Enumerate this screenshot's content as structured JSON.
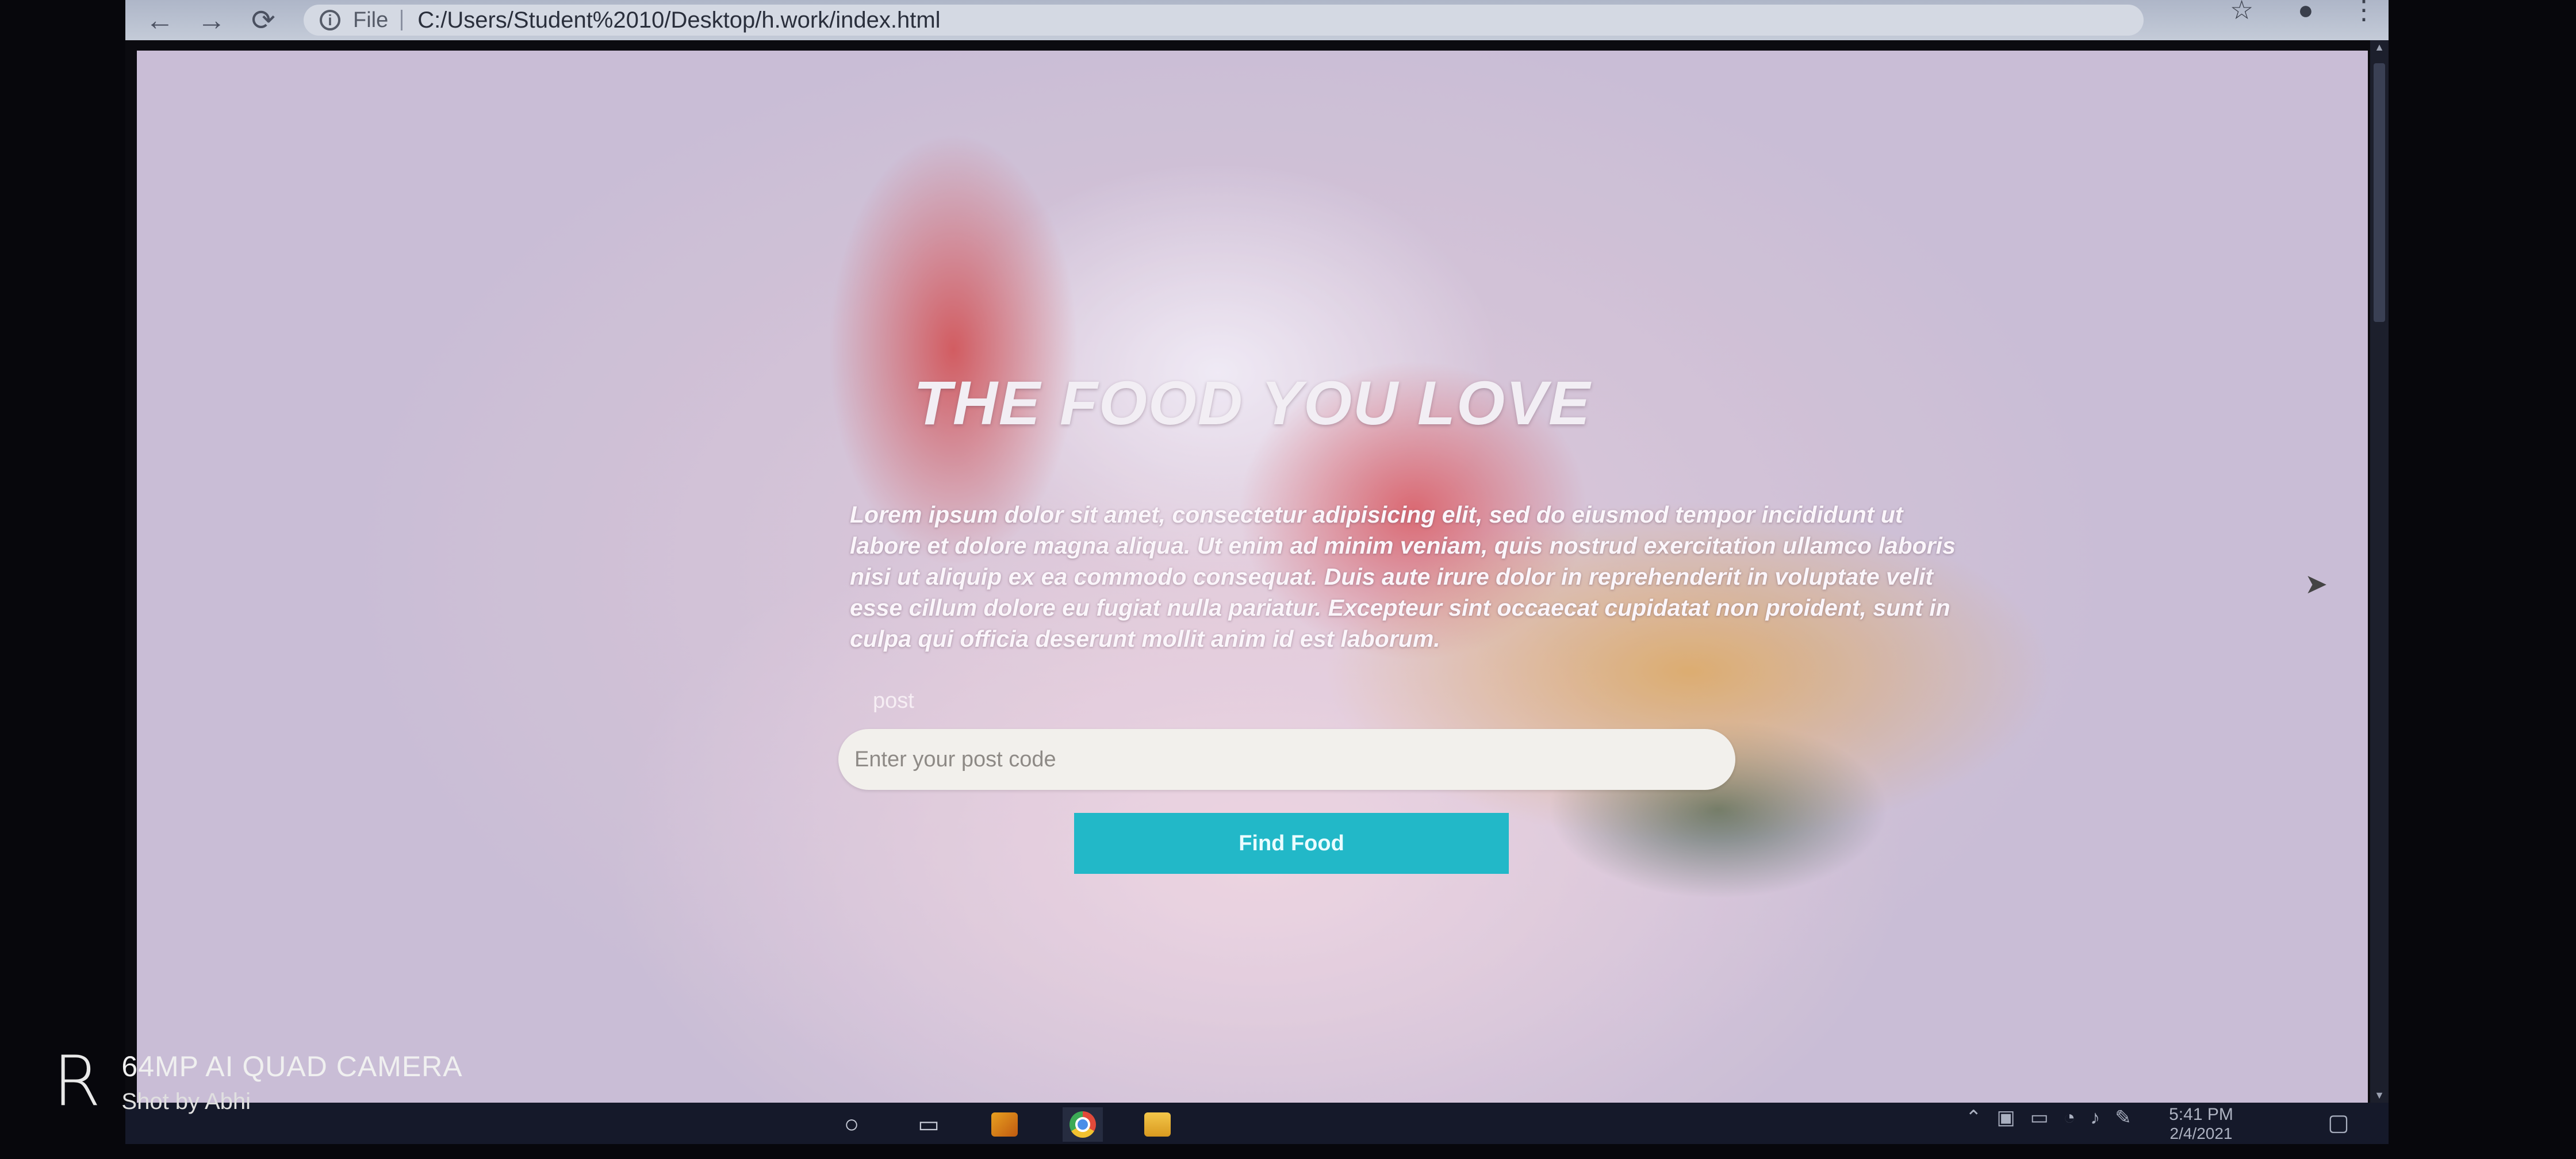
{
  "browser": {
    "back_icon": "←",
    "forward_icon": "→",
    "reload_icon": "⟳",
    "info_icon": "i",
    "file_label": "File",
    "url": "C:/Users/Student%2010/Desktop/h.work/index.html",
    "bookmark_icon": "☆",
    "extension_icon": "●",
    "menu_icon": "⋮"
  },
  "page": {
    "title": "THE FOOD YOU LOVE",
    "body_text": "Lorem ipsum dolor sit amet, consectetur adipisicing elit, sed do eiusmod tempor incididunt ut labore et dolore magna aliqua. Ut enim ad minim veniam, quis nostrud exercitation ullamco laboris nisi ut aliquip ex ea commodo consequat. Duis aute irure dolor in reprehenderit in voluptate velit esse cillum dolore eu fugiat nulla pariatur. Excepteur sint occaecat cupidatat non proident, sunt in culpa qui officia deserunt mollit anim id est laborum.",
    "post_label": "post",
    "postcode_placeholder": "Enter your post code",
    "find_button_label": "Find Food"
  },
  "taskbar": {
    "time": "5:41 PM",
    "date": "2/4/2021"
  },
  "camera_watermark": {
    "line1": "64MP AI QUAD CAMERA",
    "line2": "Shot by Abhi"
  },
  "colors": {
    "button": "#22b8c8",
    "taskbar": "#15192a"
  }
}
